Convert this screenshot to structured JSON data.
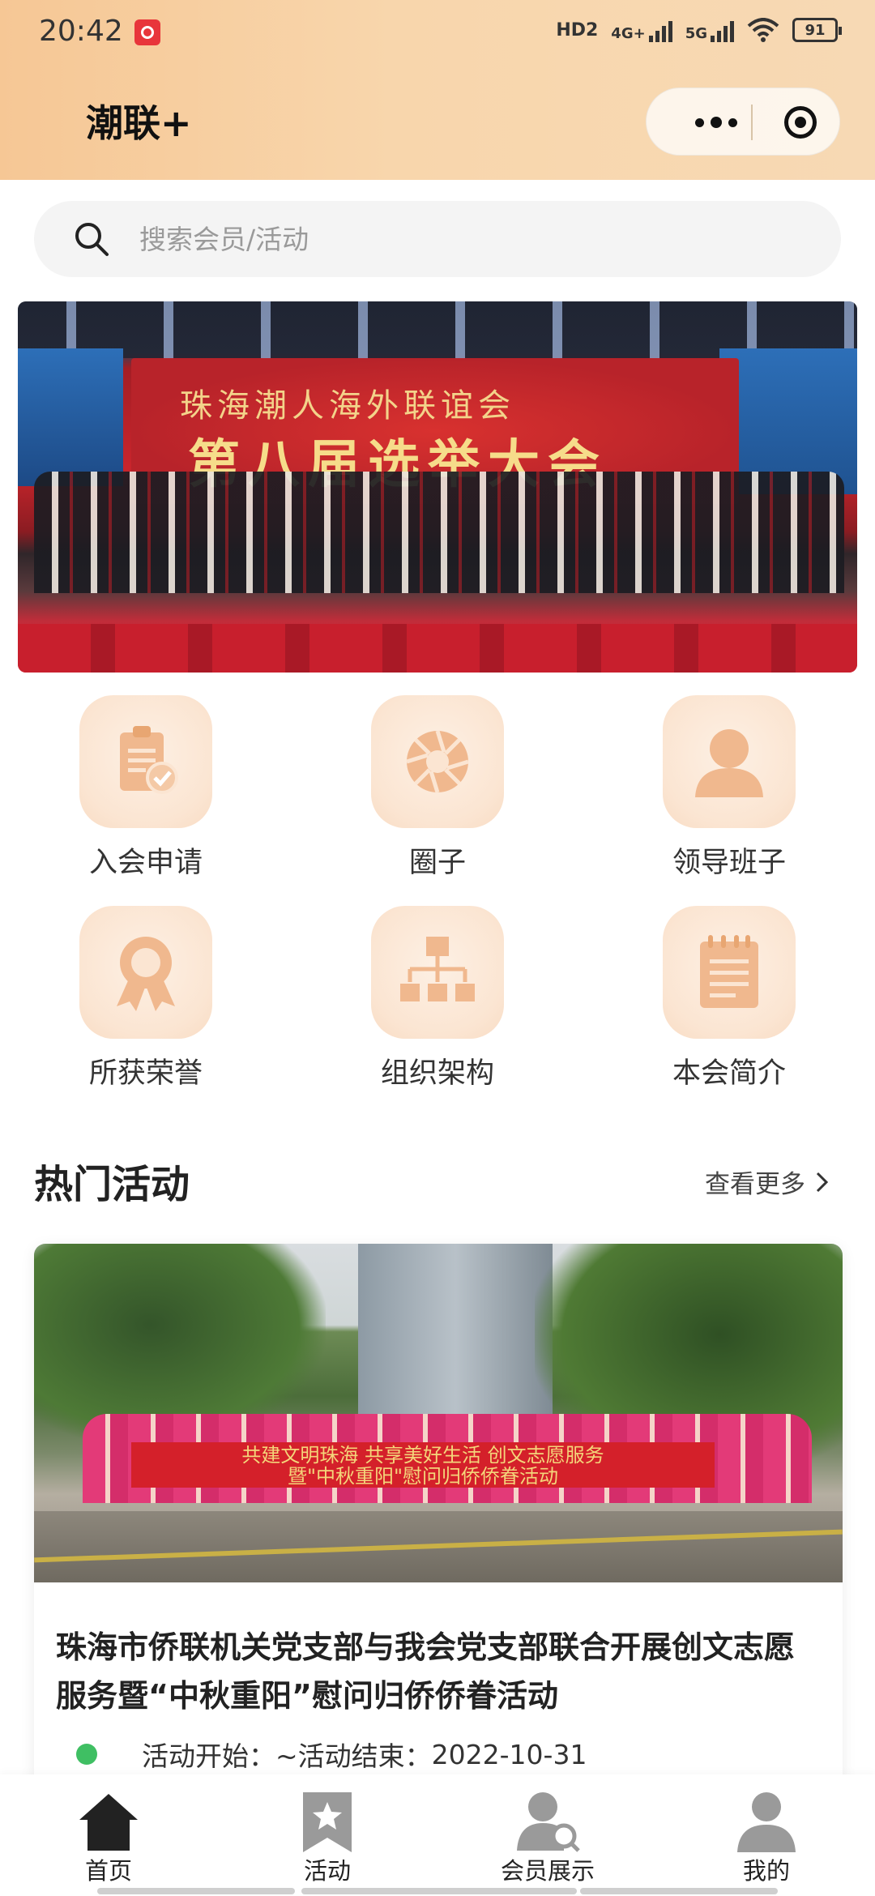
{
  "status_bar": {
    "time": "20:42",
    "network_1": "HD2",
    "network_2": "4G+",
    "network_3": "5G",
    "battery": "91"
  },
  "app": {
    "title": "潮联+"
  },
  "search": {
    "placeholder": "搜索会员/活动"
  },
  "banner": {
    "line1": "珠海潮人海外联谊会",
    "line2": "第八届选举大会"
  },
  "menu": {
    "items": [
      {
        "label": "入会申请",
        "icon": "clipboard-check-icon"
      },
      {
        "label": "圈子",
        "icon": "aperture-icon"
      },
      {
        "label": "领导班子",
        "icon": "person-icon"
      },
      {
        "label": "所获荣誉",
        "icon": "award-ribbon-icon"
      },
      {
        "label": "组织架构",
        "icon": "org-chart-icon"
      },
      {
        "label": "本会简介",
        "icon": "notepad-icon"
      }
    ],
    "icon_color": "#f0b88e",
    "icon_bg": "#fbe5d2"
  },
  "hot": {
    "title": "热门活动",
    "see_more": "查看更多",
    "activity": {
      "photo_banner": "共建文明珠海 共享美好生活 创文志愿服务\n暨\"中秋重阳\"慰问归侨侨眷活动",
      "title": "珠海市侨联机关党支部与我会党支部联合开展创文志愿服务暨“中秋重阳”慰问归侨侨眷活动",
      "start_label": "活动开始：",
      "end_label": "~活动结束：",
      "end_date": "2022-10-31"
    }
  },
  "tabbar": {
    "items": [
      {
        "label": "首页",
        "icon": "home-icon",
        "active": true
      },
      {
        "label": "活动",
        "icon": "bookmark-star-icon",
        "active": false
      },
      {
        "label": "会员展示",
        "icon": "member-search-icon",
        "active": false
      },
      {
        "label": "我的",
        "icon": "user-icon",
        "active": false
      }
    ]
  }
}
